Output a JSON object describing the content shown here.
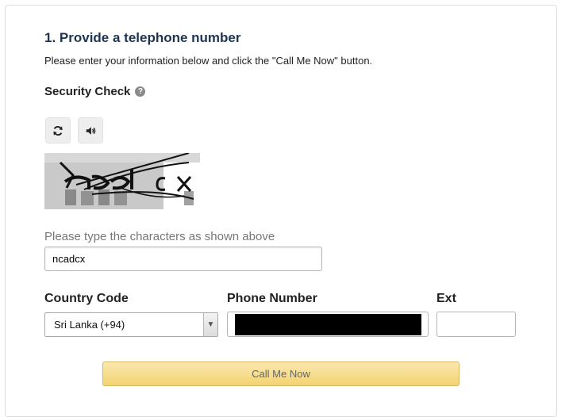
{
  "form": {
    "title": "1. Provide a telephone number",
    "intro": "Please enter your information below and click the \"Call Me Now\" button.",
    "security_check_label": "Security Check",
    "captcha_hint": "Please type the characters as shown above",
    "captcha_value": "ncadcx",
    "country_code_label": "Country Code",
    "phone_number_label": "Phone Number",
    "ext_label": "Ext",
    "country_selected": "Sri Lanka (+94)",
    "phone_value": "",
    "ext_value": "",
    "call_button_label": "Call Me Now"
  },
  "icons": {
    "help": "question-circle-icon",
    "refresh": "refresh-icon",
    "audio": "speaker-icon",
    "dropdown": "chevron-down-icon"
  },
  "colors": {
    "title": "#1e3450",
    "button_top": "#fbe8b0",
    "button_bottom": "#f2d372"
  }
}
